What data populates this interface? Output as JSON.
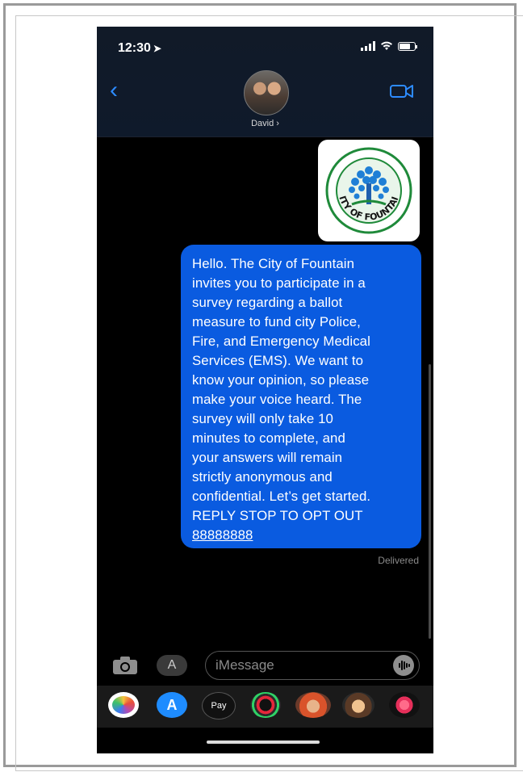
{
  "status_bar": {
    "time": "12:30",
    "location_glyph": "➤"
  },
  "header": {
    "back_label": "‹",
    "contact_name": "David ›"
  },
  "message": {
    "lines": [
      "Hello. The City of Fountain",
      "invites you to participate in a",
      "survey regarding a  ballot",
      "measure to fund city Police,",
      "Fire, and Emergency Medical",
      "Services (EMS). We want to",
      "know your opinion, so please",
      "make your voice heard. The",
      "survey will only take 10",
      "minutes to complete, and",
      "your answers will remain",
      "strictly anonymous and",
      "confidential. Let’s get started.",
      "REPLY STOP TO OPT OUT"
    ],
    "link": "88888888",
    "status": "Delivered"
  },
  "logo": {
    "text": "CITY OF FOUNTAIN",
    "ring_color": "#1f8a3a",
    "tree_color": "#1f7fd6"
  },
  "composer": {
    "placeholder": "iMessage",
    "apps_label": "A"
  },
  "app_bar": {
    "items": [
      {
        "name": "photos-app-icon",
        "color": "#ffffff"
      },
      {
        "name": "app-store-icon",
        "color": "#1e8cff"
      },
      {
        "name": "apple-pay-icon",
        "color": "#111111",
        "label": "Pay"
      },
      {
        "name": "activity-icon",
        "color": "#2a2a2a"
      },
      {
        "name": "memoji-icon",
        "color": "#d9532b"
      },
      {
        "name": "animoji-icon",
        "color": "#5a3a26"
      },
      {
        "name": "digital-touch-icon",
        "color": "#e52f5a"
      }
    ]
  }
}
